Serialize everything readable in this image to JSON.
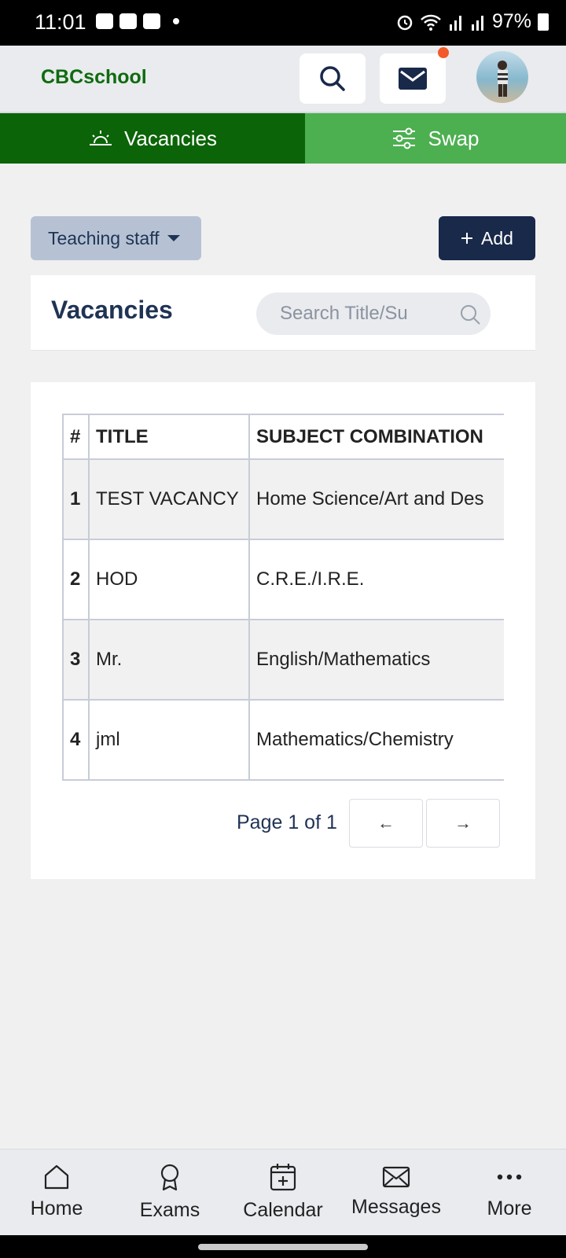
{
  "status_bar": {
    "time": "11:01",
    "battery": "97%"
  },
  "header": {
    "brand": "CBCschool",
    "has_notification": true
  },
  "tabs": [
    {
      "label": "Vacancies",
      "icon": "sunrise-icon",
      "active": true
    },
    {
      "label": "Swap",
      "icon": "sliders-icon",
      "active": false
    }
  ],
  "toolbar": {
    "staff_filter": "Teaching staff",
    "add_label": "Add"
  },
  "vacancies": {
    "title": "Vacancies",
    "search_placeholder": "Search Title/Su",
    "columns": [
      "#",
      "TITLE",
      "SUBJECT COMBINATION"
    ],
    "rows": [
      {
        "num": "1",
        "title": "TEST VACANCY",
        "subjects": "Home Science/Art and Des"
      },
      {
        "num": "2",
        "title": "HOD",
        "subjects": "C.R.E./I.R.E."
      },
      {
        "num": "3",
        "title": "Mr.",
        "subjects": "English/Mathematics"
      },
      {
        "num": "4",
        "title": "jml",
        "subjects": "Mathematics/Chemistry"
      }
    ],
    "pagination": {
      "text": "Page 1 of 1",
      "prev": "←",
      "next": "→"
    }
  },
  "bottom_nav": [
    {
      "label": "Home",
      "icon": "home-icon"
    },
    {
      "label": "Exams",
      "icon": "award-icon"
    },
    {
      "label": "Calendar",
      "icon": "calendar-plus-icon"
    },
    {
      "label": "Messages",
      "icon": "envelope-icon"
    },
    {
      "label": "More",
      "icon": "more-icon"
    }
  ],
  "colors": {
    "brand_green": "#0f6b0f",
    "tab_active": "#0b6407",
    "tab_inactive": "#4caf50",
    "navy": "#18294a",
    "notification": "#f25a2a"
  }
}
